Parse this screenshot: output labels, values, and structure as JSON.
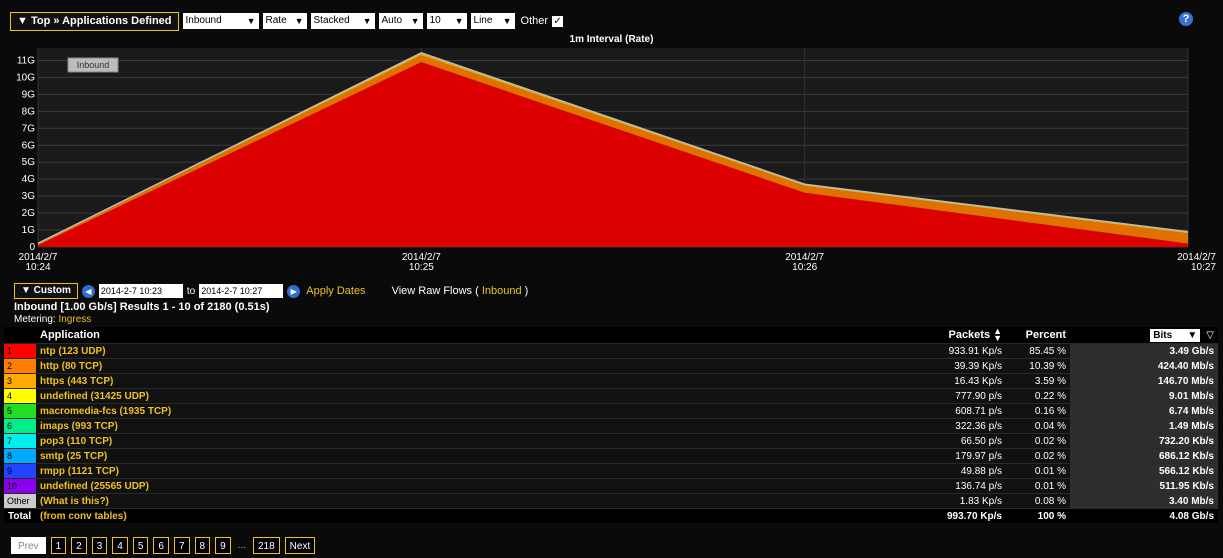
{
  "toolbar": {
    "top_label": "▼ Top » Applications Defined",
    "selects": [
      {
        "value": "Inbound",
        "width": 76
      },
      {
        "value": "Rate",
        "width": 44
      },
      {
        "value": "Stacked",
        "width": 64
      },
      {
        "value": "Auto",
        "width": 44
      },
      {
        "value": "10",
        "width": 40
      },
      {
        "value": "Line",
        "width": 44
      }
    ],
    "other_label": "Other",
    "other_checked": "✓",
    "help_label": "?"
  },
  "chart_data": {
    "type": "area",
    "stacked": true,
    "title": "1m Interval (Rate)",
    "legend_label": "Inbound",
    "x": [
      "2014/2/7 10:24",
      "2014/2/7 10:25",
      "2014/2/7 10:26",
      "2014/2/7 10:27"
    ],
    "x_tick_lines": [
      [
        "2014/2/7",
        "10:24"
      ],
      [
        "2014/2/7",
        "10:25"
      ],
      [
        "2014/2/7",
        "10:26"
      ],
      [
        "2014/2/7",
        "10:27"
      ]
    ],
    "y_ticks": [
      "0",
      "1G",
      "2G",
      "3G",
      "4G",
      "5G",
      "6G",
      "7G",
      "8G",
      "9G",
      "10G",
      "11G"
    ],
    "ylim": [
      0,
      11.5
    ],
    "grid": true,
    "series": [
      {
        "values": [
          0.1,
          10.9,
          3.2,
          0.2
        ],
        "color": "#dd0000"
      },
      {
        "values": [
          0.1,
          0.4,
          0.4,
          0.6
        ],
        "color": "#e07000"
      },
      {
        "values": [
          0.02,
          0.15,
          0.1,
          0.1
        ],
        "color": "#e8a800"
      }
    ]
  },
  "datebar": {
    "custom_label": "▼ Custom",
    "prev_icon": "◀",
    "next_icon": "▶",
    "from_value": "2014-2-7 10:23",
    "to_label": "to",
    "to_value": "2014-2-7 10:27",
    "apply_label": "Apply Dates",
    "raw_prefix": "View Raw Flows ( ",
    "raw_link": "Inbound",
    "raw_suffix": " )"
  },
  "summary": "Inbound [1.00 Gb/s] Results 1 - 10 of 2180 (0.51s)",
  "metering": {
    "label": "Metering:",
    "value": "Ingress"
  },
  "table": {
    "headers": {
      "application": "Application",
      "packets": "Packets",
      "percent": "Percent",
      "units": "Bits"
    },
    "rows": [
      {
        "rank": "1",
        "color": "#ff0000",
        "app": "ntp (123 UDP)",
        "packets": "933.91 Kp/s",
        "percent": "85.45 %",
        "bits": "3.49 Gb/s"
      },
      {
        "rank": "2",
        "color": "#ff7f00",
        "app": "http (80 TCP)",
        "packets": "39.39 Kp/s",
        "percent": "10.39 %",
        "bits": "424.40 Mb/s"
      },
      {
        "rank": "3",
        "color": "#ffaa00",
        "app": "https (443 TCP)",
        "packets": "16.43 Kp/s",
        "percent": "3.59 %",
        "bits": "146.70 Mb/s"
      },
      {
        "rank": "4",
        "color": "#ffff00",
        "app": "undefined (31425 UDP)",
        "packets": "777.90 p/s",
        "percent": "0.22 %",
        "bits": "9.01 Mb/s"
      },
      {
        "rank": "5",
        "color": "#22dd22",
        "app": "macromedia-fcs (1935 TCP)",
        "packets": "608.71 p/s",
        "percent": "0.16 %",
        "bits": "6.74 Mb/s"
      },
      {
        "rank": "6",
        "color": "#00ee88",
        "app": "imaps (993 TCP)",
        "packets": "322.36 p/s",
        "percent": "0.04 %",
        "bits": "1.49 Mb/s"
      },
      {
        "rank": "7",
        "color": "#00eeee",
        "app": "pop3 (110 TCP)",
        "packets": "66.50 p/s",
        "percent": "0.02 %",
        "bits": "732.20 Kb/s"
      },
      {
        "rank": "8",
        "color": "#00aaff",
        "app": "smtp (25 TCP)",
        "packets": "179.97 p/s",
        "percent": "0.02 %",
        "bits": "686.12 Kb/s"
      },
      {
        "rank": "9",
        "color": "#2244ff",
        "app": "rmpp (1121 TCP)",
        "packets": "49.88 p/s",
        "percent": "0.01 %",
        "bits": "566.12 Kb/s"
      },
      {
        "rank": "10",
        "color": "#8800ee",
        "app": "undefined (25565 UDP)",
        "packets": "136.74 p/s",
        "percent": "0.01 %",
        "bits": "511.95 Kb/s"
      },
      {
        "rank": "Other",
        "color": "#cccccc",
        "app": "(What is this?)",
        "packets": "1.83 Kp/s",
        "percent": "0.08 %",
        "bits": "3.40 Mb/s"
      }
    ],
    "total": {
      "rank": "Total",
      "app": "(from conv tables)",
      "packets": "993.70 Kp/s",
      "percent": "100 %",
      "bits": "4.08 Gb/s"
    }
  },
  "pager": {
    "prev": "Prev",
    "pages": [
      "1",
      "2",
      "3",
      "4",
      "5",
      "6",
      "7",
      "8",
      "9"
    ],
    "ellipsis": "...",
    "last": "218",
    "next": "Next"
  }
}
